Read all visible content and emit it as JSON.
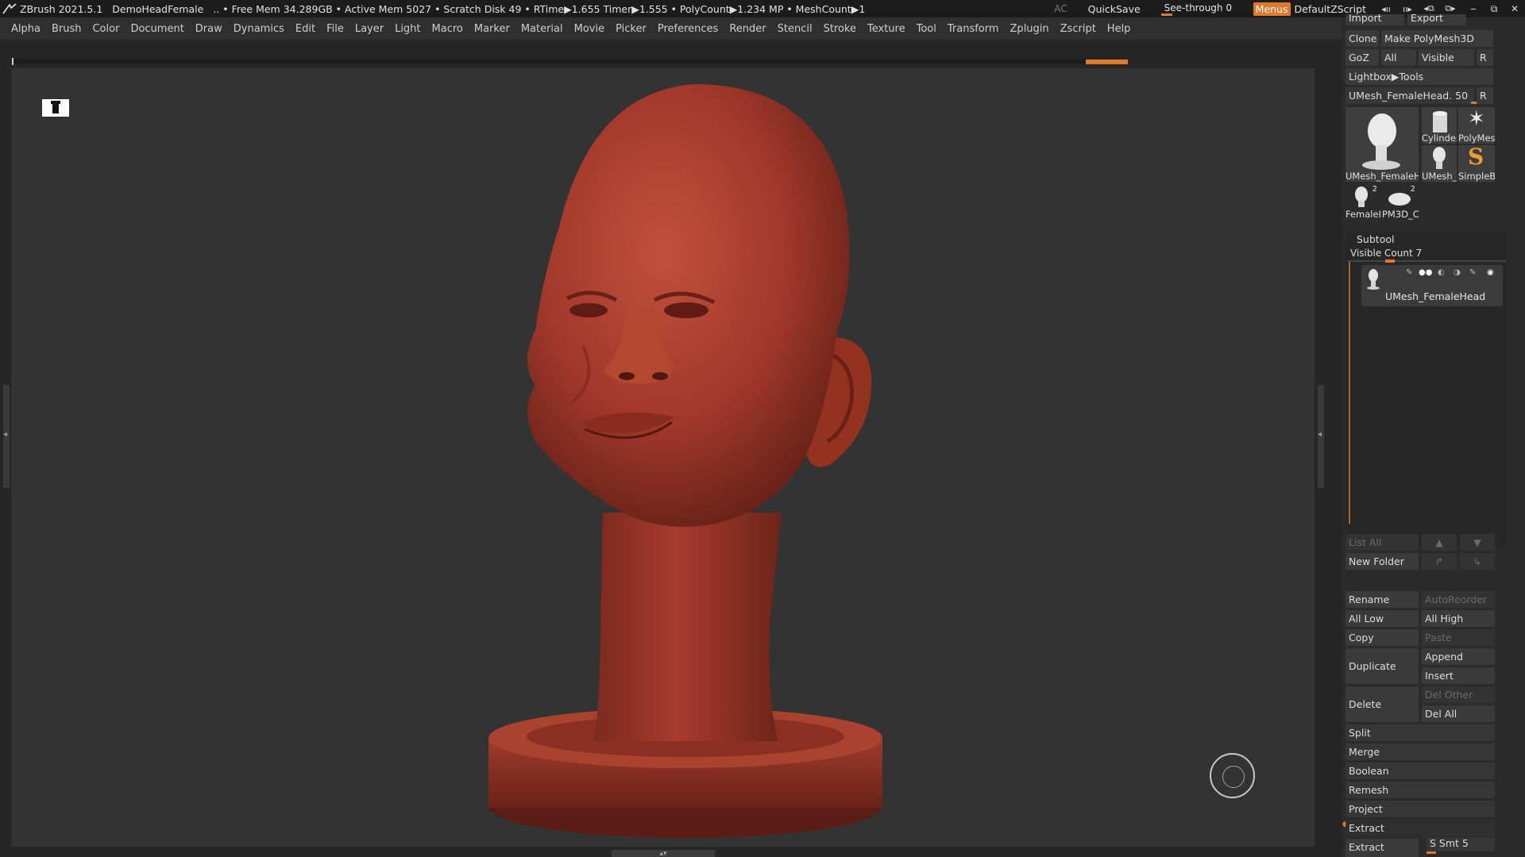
{
  "titlebar": {
    "app": "ZBrush 2021.5.1",
    "document": "DemoHeadFemale",
    "stats": ".. • Free Mem 34.289GB • Active Mem 5027 • Scratch Disk 49 • RTime▶1.655 Timer▶1.555 • PolyCount▶1.234 MP • MeshCount▶1",
    "ac": "AC",
    "quicksave": "QuickSave",
    "seethrough": "See-through  0",
    "menus": "Menus",
    "script": "DefaultZScript",
    "window_controls": [
      "‒",
      "⧉",
      "✕"
    ]
  },
  "menubar": [
    "Alpha",
    "Brush",
    "Color",
    "Document",
    "Draw",
    "Dynamics",
    "Edit",
    "File",
    "Layer",
    "Light",
    "Macro",
    "Marker",
    "Material",
    "Movie",
    "Picker",
    "Preferences",
    "Render",
    "Stencil",
    "Stroke",
    "Texture",
    "Tool",
    "Transform",
    "Zplugin",
    "Zscript",
    "Help"
  ],
  "colors": {
    "accent": "#e07a2a",
    "background": "#333333",
    "panel": "#2b2b2b",
    "model": "#a2382a"
  },
  "tool_panel": {
    "import": "Import",
    "export": "Export",
    "clone": "Clone",
    "make_polymesh": "Make PolyMesh3D",
    "goz": "GoZ",
    "all": "All",
    "visible": "Visible",
    "r": "R",
    "lightbox": "Lightbox▶Tools",
    "current_tool": "UMesh_FemaleHead. 50",
    "thumbs": {
      "main": "UMesh_FemaleH",
      "cylinder": "Cylinder",
      "polymesh": "PolyMes",
      "umesh": "UMesh_",
      "simpleb": "SimpleB",
      "female": "FemaleH",
      "female_count": "2",
      "pm3d": "PM3D_C",
      "pm3d_count": "2"
    }
  },
  "subtool": {
    "title": "Subtool",
    "visible_count": "Visible Count 7",
    "entry": "UMesh_FemaleHead",
    "list_all": "List All",
    "new_folder": "New Folder",
    "rename": "Rename",
    "autoreorder": "AutoReorder",
    "all_low": "All Low",
    "all_high": "All High",
    "copy": "Copy",
    "paste": "Paste",
    "duplicate": "Duplicate",
    "append": "Append",
    "insert": "Insert",
    "delete": "Delete",
    "del_other": "Del Other",
    "del_all": "Del All",
    "split": "Split",
    "merge": "Merge",
    "boolean": "Boolean",
    "remesh": "Remesh",
    "project": "Project",
    "extract": "Extract",
    "extract_btn": "Extract",
    "s_smt": "S Smt 5"
  }
}
